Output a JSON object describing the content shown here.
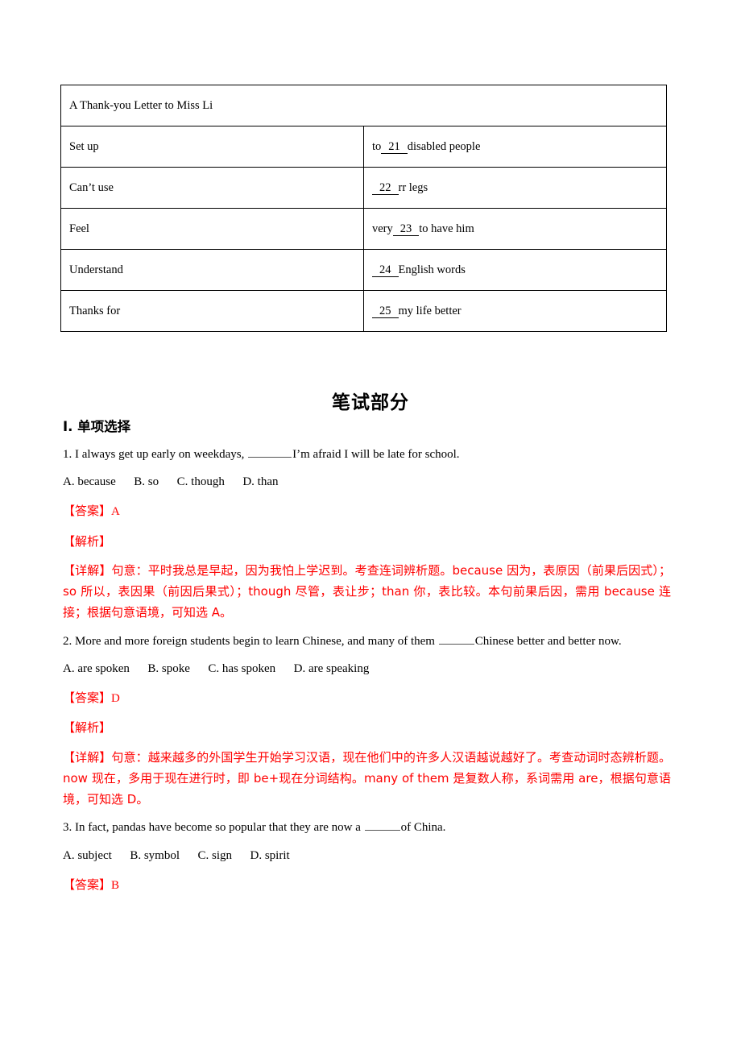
{
  "table": {
    "title": "A Thank-you Letter to Miss Li",
    "rows": [
      {
        "left": "Set up",
        "right_pre": "to",
        "blank": "21",
        "right_post": "disabled people"
      },
      {
        "left": "Can’t use",
        "right_pre": "",
        "blank": "22",
        "right_post": "rr legs"
      },
      {
        "left": "Feel",
        "right_pre": "very",
        "blank": "23",
        "right_post": "to have him"
      },
      {
        "left": "Understand",
        "right_pre": "",
        "blank": "24",
        "right_post": "English words"
      },
      {
        "left": "Thanks for",
        "right_pre": "",
        "blank": "25",
        "right_post": "my life better"
      }
    ]
  },
  "section": {
    "title": "笔试部分",
    "subheading": "I. 单项选择"
  },
  "questions": [
    {
      "stem_before": "1. I always get up early on weekdays, ",
      "stem_after": "I’m afraid I will be late for school.",
      "options": "A. because      B. so      C. though      D. than",
      "answer_label": "【答案】",
      "answer_value": "A",
      "analysis_label": "【解析】",
      "detail_label": "【详解】",
      "detail_text": "句意：平时我总是早起，因为我怕上学迟到。考查连词辨析题。because 因为，表原因（前果后因式）；so 所以，表因果（前因后果式）；though 尽管，表让步；than 你，表比较。本句前果后因，需用 because 连接；根据句意语境，可知选 A。"
    },
    {
      "stem_before": "2. More and more foreign students begin to learn Chinese, and many of them ",
      "stem_after": "Chinese better and better now.",
      "options": "A. are spoken      B. spoke      C. has spoken      D. are speaking",
      "answer_label": "【答案】",
      "answer_value": "D",
      "analysis_label": "【解析】",
      "detail_label": "【详解】",
      "detail_text": "句意：越来越多的外国学生开始学习汉语，现在他们中的许多人汉语越说越好了。考查动词时态辨析题。now 现在，多用于现在进行时，即 be+现在分词结构。many of them 是复数人称，系词需用 are，根据句意语境，可知选 D。"
    },
    {
      "stem_before": "3. In fact, pandas have become so popular that they are now a ",
      "stem_after": "of China.",
      "options": "A. subject      B. symbol      C. sign      D. spirit",
      "answer_label": "【答案】",
      "answer_value": "B"
    }
  ],
  "colors": {
    "answer_red": "#ff0000",
    "text_black": "#000000",
    "table_border": "#000000"
  }
}
